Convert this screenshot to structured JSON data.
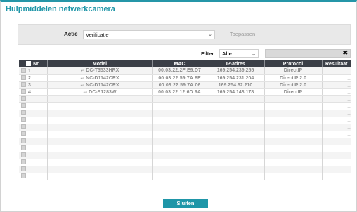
{
  "dialog": {
    "title": "Hulpmiddelen netwerkcamera",
    "accent_color": "#1f96a8"
  },
  "action": {
    "label": "Actie",
    "selected": "Verificatie",
    "apply_label": "Toepassen"
  },
  "filter": {
    "label": "Filter",
    "selected": "Alle",
    "search_value": ""
  },
  "table": {
    "columns": [
      "Nr.",
      "Model",
      "MAC",
      "IP-adres",
      "Protocol",
      "Resultaat"
    ],
    "rows": [
      {
        "nr": "1",
        "model": "DC-T3533HRX",
        "mac": "00:03:22:2F:E9:D7",
        "ip": "169.254.239.255",
        "protocol": "DirectIP",
        "result": "_"
      },
      {
        "nr": "2",
        "model": "NC-D1142CRX",
        "mac": "00:03:22:59:7A:8E",
        "ip": "169.254.231.204",
        "protocol": "DirectIP 2.0",
        "result": "_"
      },
      {
        "nr": "3",
        "model": "NC-D1142CRX",
        "mac": "00:03:22:59:7A:06",
        "ip": "169.254.62.210",
        "protocol": "DirectIP 2.0",
        "result": "_"
      },
      {
        "nr": "4",
        "model": "DC-S1283W",
        "mac": "00:03:22:12:6D:9A",
        "ip": "169.254.143.178",
        "protocol": "DirectIP",
        "result": "_"
      }
    ],
    "empty_row_count": 12,
    "empty_result": "_"
  },
  "footer": {
    "close_label": "Sluiten"
  }
}
